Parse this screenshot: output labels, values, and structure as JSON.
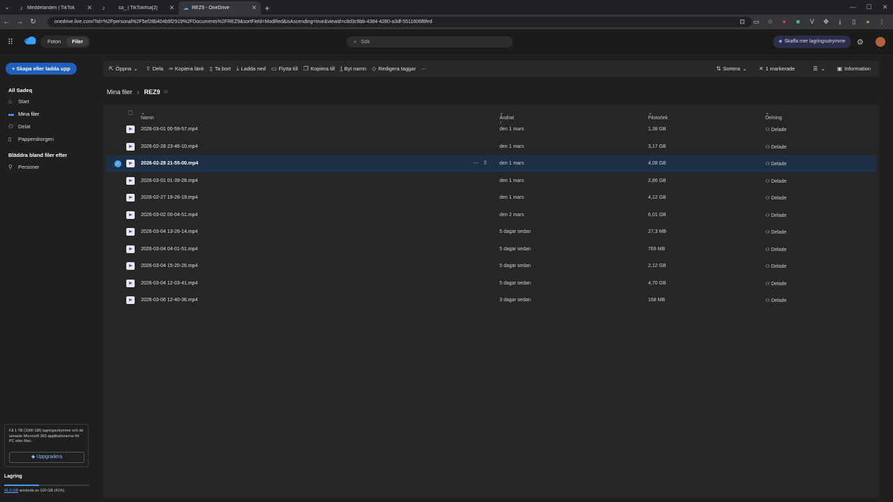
{
  "browser": {
    "tabs": [
      {
        "title": "Meddelanden | TikTok",
        "favicon": "tiktok-icon",
        "active": false
      },
      {
        "title": "sa_ | TikTok#sa[2]",
        "favicon": "tiktok-icon",
        "active": false
      },
      {
        "title": "REZ9 - OneDrive",
        "favicon": "onedrive-icon",
        "active": true
      }
    ],
    "url": "onedrive.live.com/?id=%2Fpersonal%2F5ef28b404b9f2919%2FDocuments%2FREZ9&sortField=Modified&isAscending=true&viewid=c8d3c9bb-4384-4280-a3df-5511606f8fed"
  },
  "header": {
    "toggle_photos": "Foton",
    "toggle_files": "Filer",
    "search_placeholder": "Sök",
    "premium_label": "Skaffa mer lagringsutrymme"
  },
  "sidebar": {
    "create_label": "Skapa eller ladda upp",
    "user": "All Sadeq",
    "items": [
      {
        "label": "Start",
        "icon": "home-icon"
      },
      {
        "label": "Mina filer",
        "icon": "folder-icon",
        "active": true
      },
      {
        "label": "Delat",
        "icon": "people-icon"
      },
      {
        "label": "Papperskorgen",
        "icon": "trash-icon"
      }
    ],
    "browse_section": "Bläddra bland filer efter",
    "browse_items": [
      {
        "label": "Personer",
        "icon": "person-icon"
      }
    ],
    "upsell_text": "Få 1 TB (1000 GB) lagringsutrymme och de senaste Microsoft 365-applikationerna för PC eller Mac.",
    "upgrade_label": "Uppgradera",
    "storage_title": "Lagring",
    "storage_used": "41,0 GB",
    "storage_rest": "används av 100 GB (41%)",
    "storage_fraction": 0.41
  },
  "commandbar": {
    "open": "Öppna",
    "share": "Dela",
    "copy_link": "Kopiera länk",
    "delete": "Ta bort",
    "download": "Ladda ned",
    "move": "Flytta till",
    "copy": "Kopiera till",
    "rename": "Byt namn",
    "edit_tags": "Redigera taggar",
    "more": "···",
    "sort": "Sortera",
    "selected": "1 markerade",
    "view": "☰",
    "info": "Information"
  },
  "breadcrumb": {
    "root": "Mina filer",
    "current": "REZ9"
  },
  "columns": {
    "name": "Namn",
    "modified": "Ändrat ↑",
    "size": "Filstorlek",
    "sharing": "Delning"
  },
  "files": [
    {
      "name": "2026-03-01 00-59-57.mp4",
      "modified": "den 1 mars",
      "size": "1,38 GB",
      "sharing": "Delade"
    },
    {
      "name": "2026-02-28 23-46-10.mp4",
      "modified": "den 1 mars",
      "size": "3,17 GB",
      "sharing": "Delade"
    },
    {
      "name": "2026-02-28 21-55-00.mp4",
      "modified": "den 1 mars",
      "size": "4,08 GB",
      "sharing": "Delade",
      "selected": true
    },
    {
      "name": "2026-03-01 01-39-28.mp4",
      "modified": "den 1 mars",
      "size": "2,86 GB",
      "sharing": "Delade"
    },
    {
      "name": "2026-02-27 19-26-19.mp4",
      "modified": "den 1 mars",
      "size": "4,12 GB",
      "sharing": "Delade"
    },
    {
      "name": "2026-03-02 00-04-51.mp4",
      "modified": "den 2 mars",
      "size": "6,01 GB",
      "sharing": "Delade"
    },
    {
      "name": "2026-03-04 13-26-14.mp4",
      "modified": "5 dagar sedan",
      "size": "27,3 MB",
      "sharing": "Delade"
    },
    {
      "name": "2026-03-04 04-01-51.mp4",
      "modified": "5 dagar sedan",
      "size": "769 MB",
      "sharing": "Delade"
    },
    {
      "name": "2026-03-04 15-20-26.mp4",
      "modified": "5 dagar sedan",
      "size": "2,12 GB",
      "sharing": "Delade"
    },
    {
      "name": "2026-03-04 12-03-41.mp4",
      "modified": "5 dagar sedan",
      "size": "4,70 GB",
      "sharing": "Delade"
    },
    {
      "name": "2026-03-06 12-40-36.mp4",
      "modified": "3 dagar sedan",
      "size": "168 MB",
      "sharing": "Delade"
    }
  ],
  "colors": {
    "accent": "#1f5fbf",
    "selected_row": "#1d2f45",
    "file_icon_play": "#6b3fbf"
  }
}
